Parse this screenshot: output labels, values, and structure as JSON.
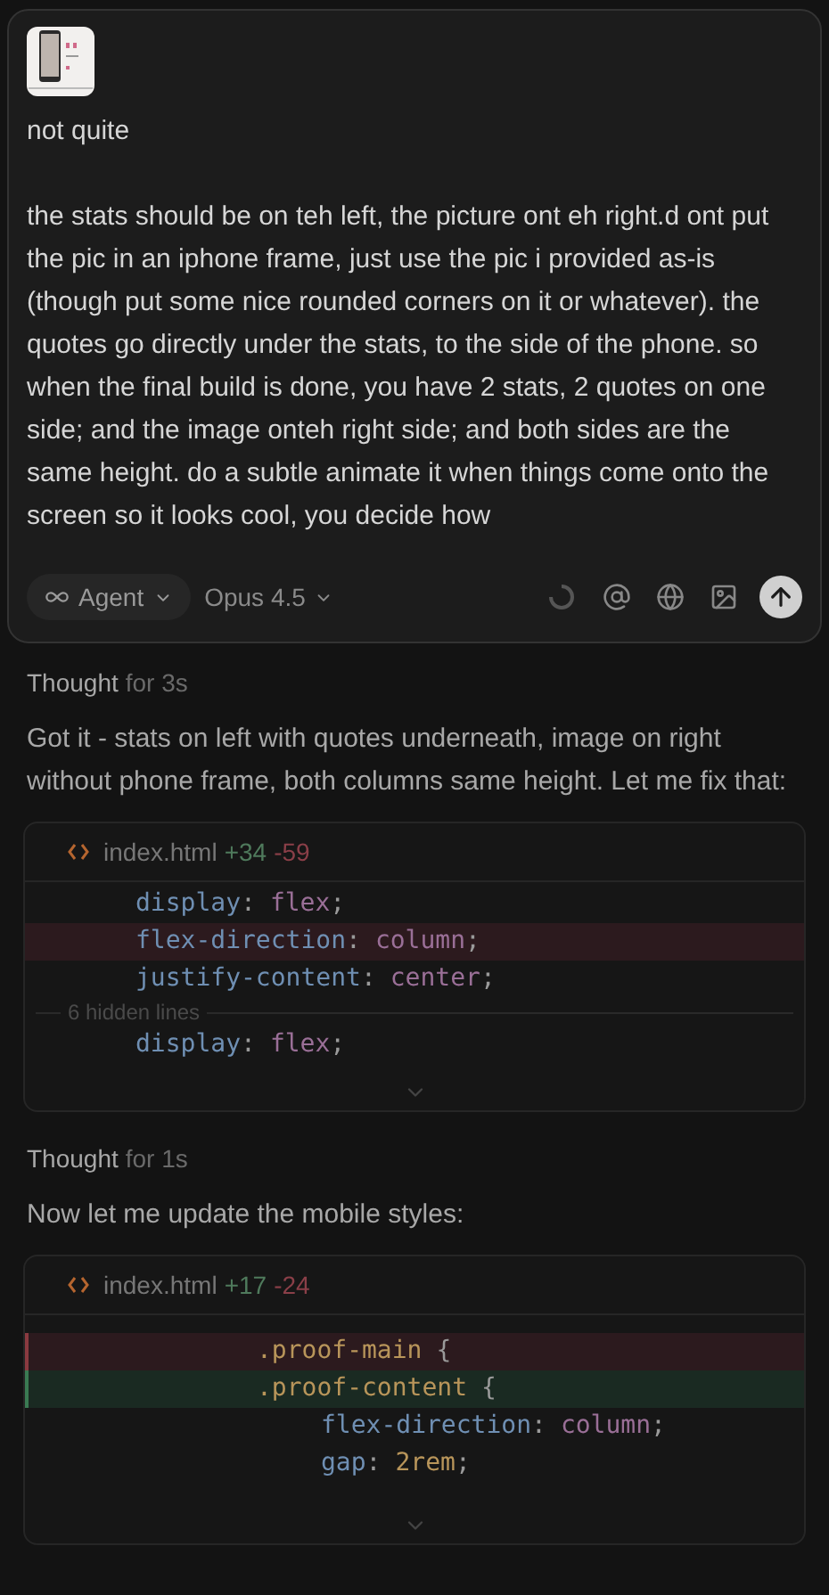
{
  "composer": {
    "message": [
      "not quite",
      "the stats should be on teh left, the picture ont eh right.d ont put the pic in an iphone frame, just use the pic i provided as-is (though put some nice rounded corners on it or whatever). the quotes go directly under the stats, to the side of the phone. so when the final build is done, you have 2 stats, 2 quotes on one side; and the image onteh right side; and both sides are the same height. do a subtle animate it when things come onto the screen so it looks cool, you decide how"
    ],
    "mode": "Agent",
    "model": "Opus 4.5",
    "busy": true
  },
  "conversation": [
    {
      "kind": "thought",
      "label": "Thought",
      "duration": "for 3s"
    },
    {
      "kind": "text",
      "text": "Got it - stats on left with quotes underneath, image on right without phone frame, both columns same height. Let me fix that:"
    },
    {
      "kind": "diff",
      "file": "index.html",
      "added": "+34",
      "removed": "-59",
      "change_bars": false,
      "lines": [
        {
          "kind": "context",
          "tokens": [
            {
              "kind": "property",
              "text": "display"
            },
            {
              "kind": "punct",
              "text": ":"
            },
            {
              "kind": "value",
              "text": "flex"
            },
            {
              "kind": "punct",
              "text": ";"
            }
          ]
        },
        {
          "kind": "removed",
          "tokens": [
            {
              "kind": "property",
              "text": "flex-direction"
            },
            {
              "kind": "punct",
              "text": ":"
            },
            {
              "kind": "value",
              "text": "column"
            },
            {
              "kind": "punct",
              "text": ";"
            }
          ]
        },
        {
          "kind": "context",
          "tokens": [
            {
              "kind": "property",
              "text": "justify-content"
            },
            {
              "kind": "punct",
              "text": ":"
            },
            {
              "kind": "value",
              "text": "center"
            },
            {
              "kind": "punct",
              "text": ";"
            }
          ]
        },
        {
          "kind": "hidden",
          "text": "6 hidden lines"
        },
        {
          "kind": "context",
          "tokens": [
            {
              "kind": "property",
              "text": "display"
            },
            {
              "kind": "punct",
              "text": ":"
            },
            {
              "kind": "value",
              "text": "flex"
            },
            {
              "kind": "punct",
              "text": ";"
            }
          ]
        }
      ]
    },
    {
      "kind": "thought",
      "label": "Thought",
      "duration": "for 1s"
    },
    {
      "kind": "text",
      "text": "Now let me update the mobile styles:"
    },
    {
      "kind": "diff",
      "file": "index.html",
      "added": "+17",
      "removed": "-24",
      "change_bars": true,
      "lines": [
        {
          "kind": "removed",
          "tokens": [
            {
              "kind": "selector",
              "text": ".proof-main"
            },
            {
              "kind": "punct",
              "text": "{"
            }
          ]
        },
        {
          "kind": "added",
          "tokens": [
            {
              "kind": "selector",
              "text": ".proof-content"
            },
            {
              "kind": "punct",
              "text": "{"
            }
          ]
        },
        {
          "kind": "context",
          "tokens": [
            {
              "kind": "property",
              "text": "flex-direction"
            },
            {
              "kind": "punct",
              "text": ":"
            },
            {
              "kind": "value",
              "text": "column"
            },
            {
              "kind": "punct",
              "text": ";"
            }
          ]
        },
        {
          "kind": "context",
          "tokens": [
            {
              "kind": "property",
              "text": "gap"
            },
            {
              "kind": "punct",
              "text": ":"
            },
            {
              "kind": "number",
              "text": "2rem"
            },
            {
              "kind": "punct",
              "text": ";"
            }
          ]
        }
      ]
    }
  ]
}
